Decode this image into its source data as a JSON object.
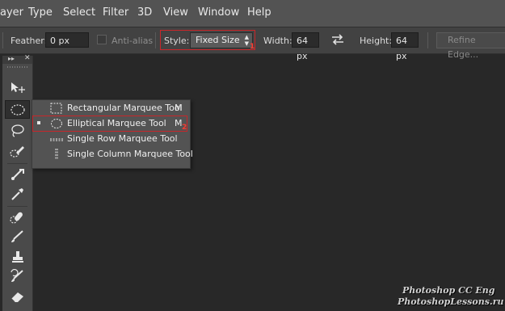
{
  "menu": {
    "items": [
      "ayer",
      "Type",
      "Select",
      "Filter",
      "3D",
      "View",
      "Window",
      "Help"
    ]
  },
  "options": {
    "feather_label": "Feather:",
    "feather_value": "0 px",
    "antialias_label": "Anti-alias",
    "style_label": "Style:",
    "style_value": "Fixed Size",
    "width_label": "Width:",
    "width_value": "64 px",
    "height_label": "Height:",
    "height_value": "64 px",
    "refine_label": "Refine Edge...",
    "annotation_1": "1"
  },
  "toolbar": {
    "tools": [
      "move-tool",
      "elliptical-marquee-tool",
      "lasso-tool",
      "quick-selection-tool",
      "crop-tool",
      "eyedropper-tool",
      "spot-healing-brush-tool",
      "brush-tool",
      "clone-stamp-tool",
      "history-brush-tool",
      "eraser-tool"
    ]
  },
  "flyout": {
    "items": [
      {
        "label": "Rectangular Marquee Tool",
        "shortcut": "M",
        "icon": "rectangular-marquee-icon",
        "selected": false
      },
      {
        "label": "Elliptical Marquee Tool",
        "shortcut": "M",
        "icon": "elliptical-marquee-icon",
        "selected": true
      },
      {
        "label": "Single Row Marquee Tool",
        "shortcut": "",
        "icon": "single-row-marquee-icon",
        "selected": false
      },
      {
        "label": "Single Column Marquee Tool",
        "shortcut": "",
        "icon": "single-column-marquee-icon",
        "selected": false
      }
    ],
    "annotation_2": "2"
  },
  "watermark": {
    "line1": "Photoshop CC Eng",
    "line2": "PhotoshopLessons.ru"
  },
  "colors": {
    "accent_red": "#c8262a",
    "canvas": "#282828",
    "panel": "#535353"
  }
}
